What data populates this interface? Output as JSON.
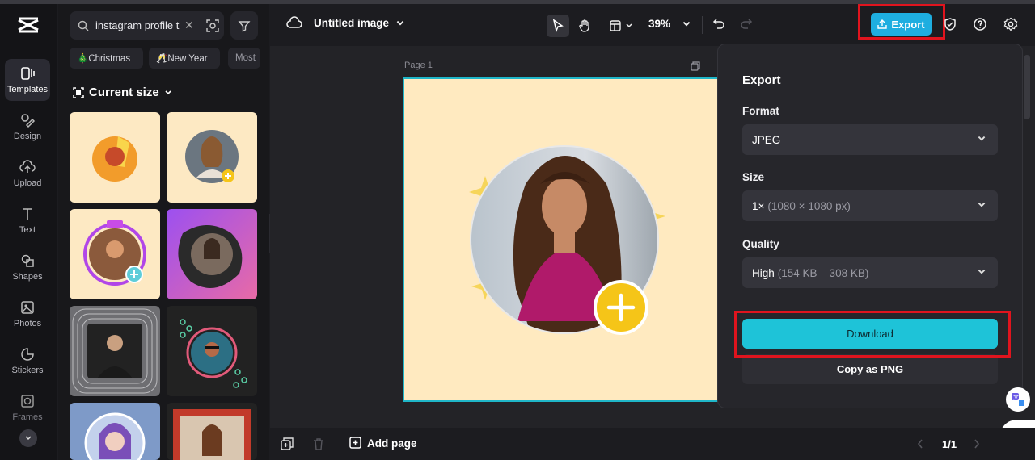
{
  "app": {
    "logo": "capcut-logo-icon"
  },
  "rail": {
    "items": [
      {
        "label": "Templates",
        "icon": "templates-icon"
      },
      {
        "label": "Design",
        "icon": "design-icon"
      },
      {
        "label": "Upload",
        "icon": "upload-icon"
      },
      {
        "label": "Text",
        "icon": "text-icon"
      },
      {
        "label": "Shapes",
        "icon": "shapes-icon"
      },
      {
        "label": "Photos",
        "icon": "photos-icon"
      },
      {
        "label": "Stickers",
        "icon": "stickers-icon"
      },
      {
        "label": "Frames",
        "icon": "frames-icon"
      }
    ]
  },
  "panel": {
    "search_value": "instagram profile t",
    "chips": [
      "🎄Christmas",
      "🥂New Year",
      "Most"
    ],
    "current_size_label": "Current size"
  },
  "toolbar": {
    "doc_title": "Untitled image",
    "zoom": "39%",
    "export_label": "Export"
  },
  "canvas": {
    "page_label": "Page 1"
  },
  "export_panel": {
    "title": "Export",
    "format_label": "Format",
    "format_value": "JPEG",
    "size_label": "Size",
    "size_value": "1×",
    "size_detail": "(1080 × 1080 px)",
    "quality_label": "Quality",
    "quality_value": "High",
    "quality_detail": "(154 KB – 308 KB)",
    "download_label": "Download",
    "copy_label": "Copy as PNG"
  },
  "bottombar": {
    "add_page_label": "Add page",
    "page_counter": "1/1"
  },
  "colors": {
    "accent": "#1ec3d8",
    "export_button": "#1eaee0",
    "highlight": "#e0141e",
    "canvas_bg": "#ffeac0",
    "plus_badge": "#f5c518"
  }
}
